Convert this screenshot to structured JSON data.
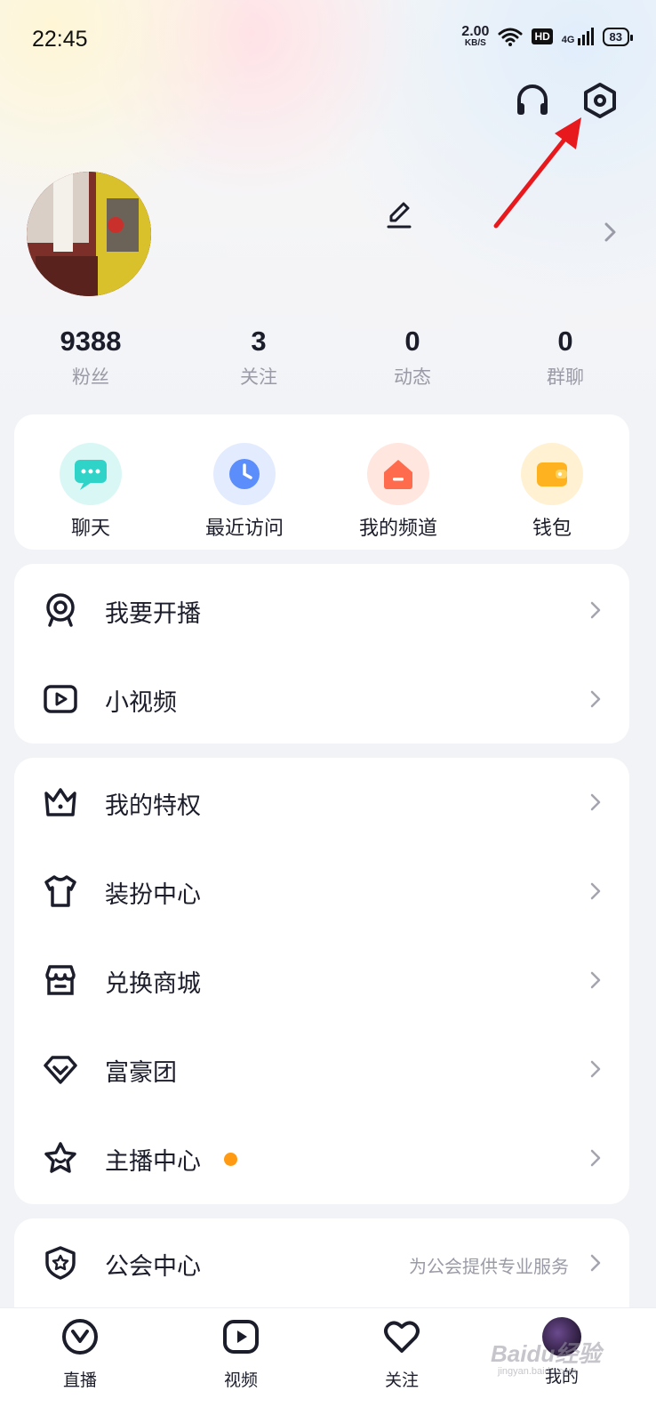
{
  "status_bar": {
    "time": "22:45",
    "net_speed": "2.00",
    "net_unit": "KB/S",
    "hd": "HD",
    "signal": "4G",
    "battery": "83"
  },
  "header": {
    "headset_icon": "headset-icon",
    "settings_icon": "settings-hexagon-icon"
  },
  "profile": {
    "edit_icon": "pencil-icon"
  },
  "stats": [
    {
      "value": "9388",
      "label": "粉丝"
    },
    {
      "value": "3",
      "label": "关注"
    },
    {
      "value": "0",
      "label": "动态"
    },
    {
      "value": "0",
      "label": "群聊"
    }
  ],
  "quick_actions": [
    {
      "label": "聊天",
      "icon": "chat-bubble-icon",
      "color": "#2fd3c8"
    },
    {
      "label": "最近访问",
      "icon": "clock-icon",
      "color": "#5b8dfb"
    },
    {
      "label": "我的频道",
      "icon": "home-icon",
      "color": "#ff6b4d"
    },
    {
      "label": "钱包",
      "icon": "wallet-icon",
      "color": "#ffb21f"
    }
  ],
  "menu_group1": [
    {
      "label": "我要开播",
      "icon": "webcam-icon"
    },
    {
      "label": "小视频",
      "icon": "video-play-icon"
    }
  ],
  "menu_group2": [
    {
      "label": "我的特权",
      "icon": "crown-icon"
    },
    {
      "label": "装扮中心",
      "icon": "tshirt-icon"
    },
    {
      "label": "兑换商城",
      "icon": "store-icon"
    },
    {
      "label": "富豪团",
      "icon": "diamond-icon"
    },
    {
      "label": "主播中心",
      "icon": "star-icon"
    }
  ],
  "menu_group3": [
    {
      "label": "公会中心",
      "icon": "shield-star-icon",
      "subtitle": "为公会提供专业服务"
    }
  ],
  "tabbar": [
    {
      "label": "直播",
      "icon": "live-y-icon"
    },
    {
      "label": "视频",
      "icon": "video-tab-icon"
    },
    {
      "label": "关注",
      "icon": "heart-icon"
    },
    {
      "label": "我的",
      "icon": "avatar-tab-icon"
    }
  ],
  "watermark": {
    "text": "Baidu经验",
    "sub": "jingyan.baidu.com"
  },
  "colors": {
    "accent_dot": "#ff9a12",
    "annotation_arrow": "#e8191d",
    "text_primary": "#1c1d2b",
    "text_secondary": "#9a9ba6"
  }
}
